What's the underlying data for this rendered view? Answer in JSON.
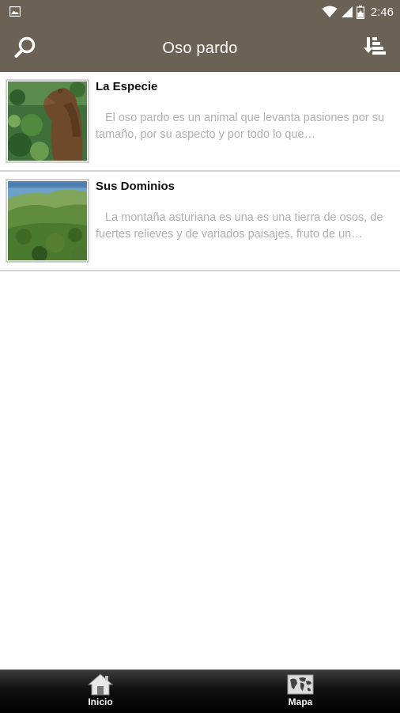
{
  "status_bar": {
    "time": "2:46",
    "icons": [
      "photo-notification-icon",
      "wifi-icon",
      "signal-icon",
      "battery-icon"
    ]
  },
  "app_bar": {
    "title": "Oso pardo",
    "left_icon": "search-icon",
    "right_icon": "sort-icon",
    "background": "#6b6255"
  },
  "list": {
    "items": [
      {
        "title": "La Especie",
        "description": "El oso pardo es un animal que levanta pasiones por su tamaño, por su aspecto y por todo lo que…",
        "thumbnail": "brown-bear-photo"
      },
      {
        "title": "Sus Dominios",
        "description": "La montaña asturiana es una es una tierra de osos, de fuertes relieves y de variados paisajes, fruto de un…",
        "thumbnail": "mountain-landscape-photo"
      }
    ]
  },
  "bottom_nav": {
    "items": [
      {
        "label": "Inicio",
        "icon": "home-icon"
      },
      {
        "label": "Mapa",
        "icon": "world-map-icon"
      }
    ]
  }
}
